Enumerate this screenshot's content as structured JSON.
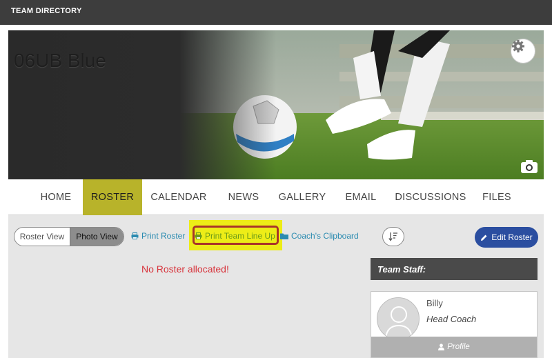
{
  "header": {
    "title": "TEAM DIRECTORY"
  },
  "banner": {
    "team_name": "06UB Blue",
    "icons": [
      "gear-icon",
      "camera-icon"
    ]
  },
  "nav": {
    "items": [
      {
        "label": "HOME"
      },
      {
        "label": "ROSTER",
        "active": true
      },
      {
        "label": "CALENDAR"
      },
      {
        "label": "NEWS"
      },
      {
        "label": "GALLERY"
      },
      {
        "label": "EMAIL"
      },
      {
        "label": "DISCUSSIONS"
      },
      {
        "label": "FILES"
      }
    ],
    "active_color": "#b8b32a"
  },
  "toolbar": {
    "view_toggle": {
      "left": "Roster View",
      "right": "Photo View",
      "selected": "Photo View"
    },
    "print_roster": "Print Roster",
    "print_lineup": "Print Team Line Up",
    "clipboard": "Coach's Clipboard",
    "edit_roster": "Edit Roster"
  },
  "roster": {
    "empty_message": "No Roster allocated!"
  },
  "staff": {
    "header": "Team Staff:",
    "members": [
      {
        "name": "Billy",
        "role": "Head Coach",
        "profile_label": "Profile"
      }
    ]
  },
  "colors": {
    "accent_blue": "#2b4ea0",
    "link": "#2b8bb0",
    "error": "#d7333b",
    "highlight": "#eded17"
  }
}
